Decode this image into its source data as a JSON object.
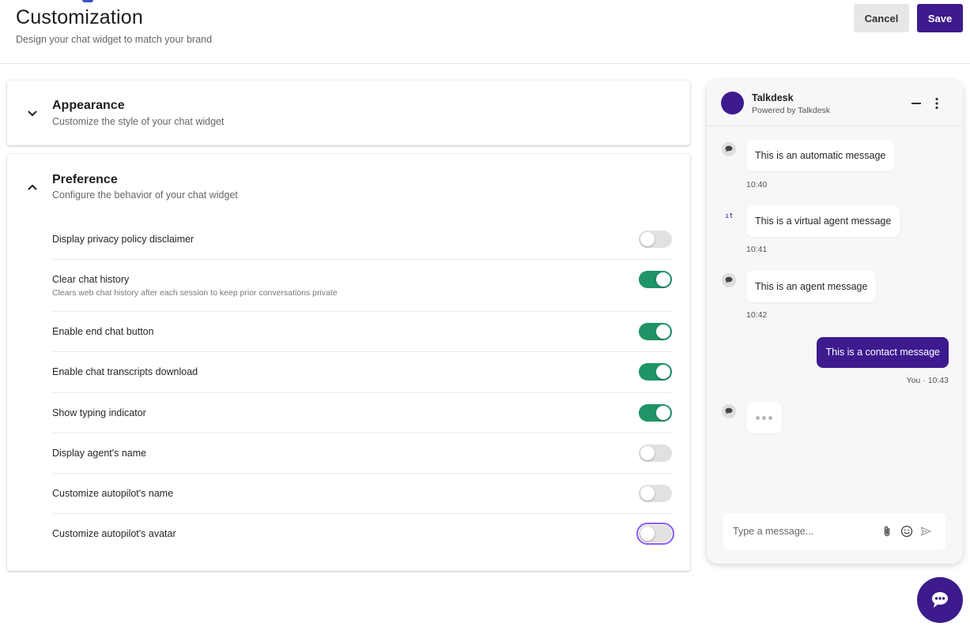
{
  "header": {
    "title": "Customization",
    "subtitle": "Design your chat widget to match your brand",
    "cancel_label": "Cancel",
    "save_label": "Save"
  },
  "appearance": {
    "title": "Appearance",
    "subtitle": "Customize the style of your chat widget",
    "expanded": false
  },
  "preference": {
    "title": "Preference",
    "subtitle": "Configure the behavior of your chat widget",
    "expanded": true,
    "items": [
      {
        "label": "Display privacy policy disclaimer",
        "description": "",
        "on": false
      },
      {
        "label": "Clear chat history",
        "description": "Clears web chat history after each session to keep prior conversations private",
        "on": true
      },
      {
        "label": "Enable end chat button",
        "description": "",
        "on": true
      },
      {
        "label": "Enable chat transcripts download",
        "description": "",
        "on": true
      },
      {
        "label": "Show typing indicator",
        "description": "",
        "on": true
      },
      {
        "label": "Display agent's name",
        "description": "",
        "on": false
      },
      {
        "label": "Customize autopilot's name",
        "description": "",
        "on": false
      },
      {
        "label": "Customize autopilot's avatar",
        "description": "",
        "on": false,
        "focused": true
      }
    ]
  },
  "widget": {
    "name": "Talkdesk",
    "powered_by": "Powered by Talkdesk",
    "messages": [
      {
        "text": "This is an automatic message",
        "time": "10:40",
        "icon": "chat-bubble-icon"
      },
      {
        "text": "This is a virtual agent message",
        "time": "10:41",
        "icon": "virtual-agent-icon"
      },
      {
        "text": "This is an agent message",
        "time": "10:42",
        "icon": "chat-bubble-icon"
      }
    ],
    "contact_message": {
      "text": "This is a contact message",
      "time": "You · 10:43"
    },
    "typing_indicator": true,
    "composer_placeholder": "Type a message..."
  },
  "colors": {
    "brand": "#3d1a8e",
    "toggle_on": "#1f9466",
    "toggle_off": "#e1e1e1",
    "focus_ring": "#8a5cf5"
  }
}
